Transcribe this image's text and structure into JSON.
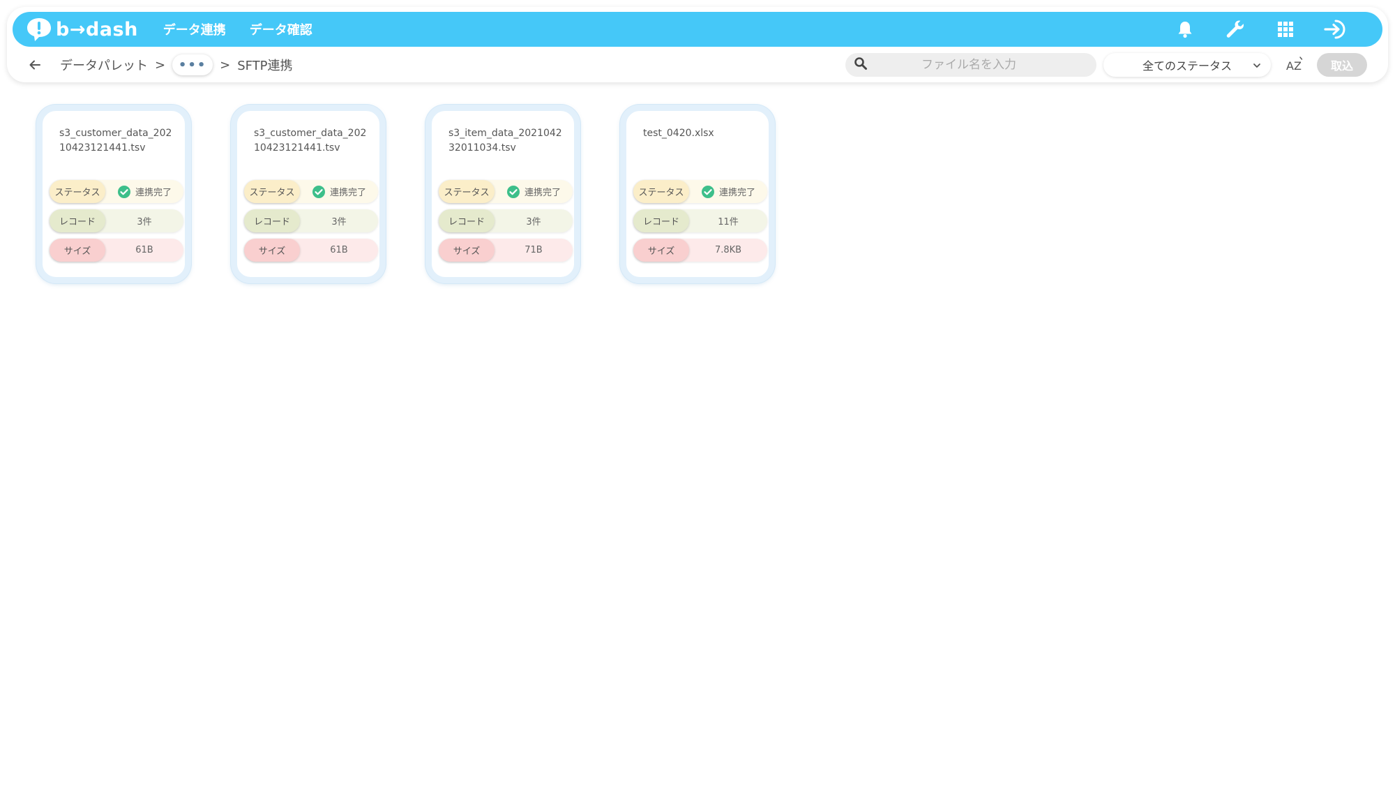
{
  "header": {
    "logo_text": "b→dash",
    "nav": [
      {
        "label": "データ連携"
      },
      {
        "label": "データ確認"
      }
    ],
    "icons": [
      "bell-icon",
      "wrench-icon",
      "grid-icon",
      "sign-in-icon"
    ]
  },
  "subbar": {
    "breadcrumb": {
      "root": "データパレット",
      "sep": ">",
      "ellipsis": "•••",
      "current": "SFTP連携"
    },
    "search": {
      "placeholder": "ファイル名を入力",
      "value": ""
    },
    "status_filter": {
      "selected": "全てのステータス"
    },
    "sort_label": "AZ",
    "import_label": "取込"
  },
  "labels": {
    "status": "ステータス",
    "record": "レコード",
    "size": "サイズ"
  },
  "files": [
    {
      "name": "s3_customer_data_20210423121441.tsv",
      "status": "連携完了",
      "records": "3件",
      "size": "61B"
    },
    {
      "name": "s3_customer_data_20210423121441.tsv",
      "status": "連携完了",
      "records": "3件",
      "size": "61B"
    },
    {
      "name": "s3_item_data_202104232011034.tsv",
      "status": "連携完了",
      "records": "3件",
      "size": "71B"
    },
    {
      "name": "test_0420.xlsx",
      "status": "連携完了",
      "records": "11件",
      "size": "7.8KB"
    }
  ],
  "colors": {
    "header_bg": "#45c8f8",
    "status_ok": "#3dbf8a",
    "card_border": "#e2f0fb"
  }
}
